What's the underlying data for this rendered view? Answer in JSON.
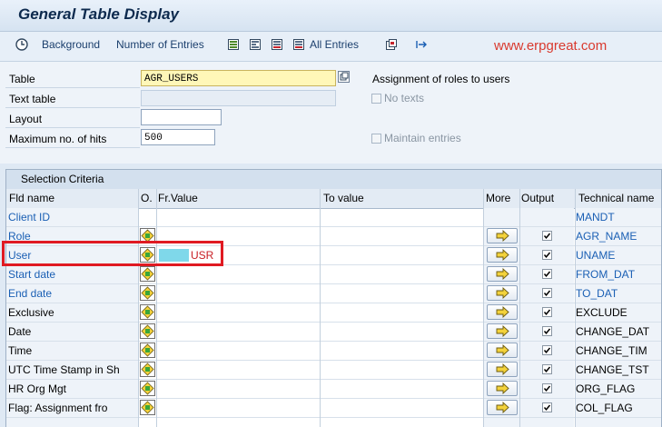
{
  "window": {
    "title": "General Table Display"
  },
  "toolbar": {
    "background": "Background",
    "number_of_entries": "Number of Entries",
    "all_entries": "All Entries"
  },
  "watermark": "www.erpgreat.com",
  "form": {
    "table_label": "Table",
    "table_value": "AGR_USERS",
    "table_description": "Assignment of roles to users",
    "text_table_label": "Text table",
    "no_texts_label": "No texts",
    "layout_label": "Layout",
    "layout_value": "",
    "max_hits_label": "Maximum no. of hits",
    "max_hits_value": "500",
    "maintain_entries_label": "Maintain entries"
  },
  "selection": {
    "caption": "Selection Criteria",
    "columns": {
      "fld_name": "Fld name",
      "option": "O.",
      "from_value": "Fr.Value",
      "to_value": "To value",
      "more": "More",
      "output": "Output",
      "technical_name": "Technical name"
    },
    "rows": [
      {
        "name": "Client ID",
        "from": "",
        "technical": "MANDT",
        "blue": true,
        "has_option": false,
        "has_more": false,
        "output": false
      },
      {
        "name": "Role",
        "from": "",
        "technical": "AGR_NAME",
        "blue": true,
        "has_option": true,
        "has_more": true,
        "output": true
      },
      {
        "name": "User",
        "from": "USR",
        "technical": "UNAME",
        "blue": true,
        "has_option": true,
        "has_more": true,
        "output": true
      },
      {
        "name": "Start date",
        "from": "",
        "technical": "FROM_DAT",
        "blue": true,
        "has_option": true,
        "has_more": true,
        "output": true
      },
      {
        "name": "End date",
        "from": "",
        "technical": "TO_DAT",
        "blue": true,
        "has_option": true,
        "has_more": true,
        "output": true
      },
      {
        "name": "Exclusive",
        "from": "",
        "technical": "EXCLUDE",
        "blue": false,
        "has_option": true,
        "has_more": true,
        "output": true
      },
      {
        "name": "Date",
        "from": "",
        "technical": "CHANGE_DAT",
        "blue": false,
        "has_option": true,
        "has_more": true,
        "output": true
      },
      {
        "name": "Time",
        "from": "",
        "technical": "CHANGE_TIM",
        "blue": false,
        "has_option": true,
        "has_more": true,
        "output": true
      },
      {
        "name": "UTC Time Stamp in Sh",
        "from": "",
        "technical": "CHANGE_TST",
        "blue": false,
        "has_option": true,
        "has_more": true,
        "output": true
      },
      {
        "name": "HR Org Mgt",
        "from": "",
        "technical": "ORG_FLAG",
        "blue": false,
        "has_option": true,
        "has_more": true,
        "output": true
      },
      {
        "name": "Flag: Assignment fro",
        "from": "",
        "technical": "COL_FLAG",
        "blue": false,
        "has_option": true,
        "has_more": true,
        "output": true
      }
    ]
  },
  "colors": {
    "link_blue": "#1a5fb4",
    "highlight_red": "#e01a22",
    "field_yellow": "#fff7b8"
  }
}
